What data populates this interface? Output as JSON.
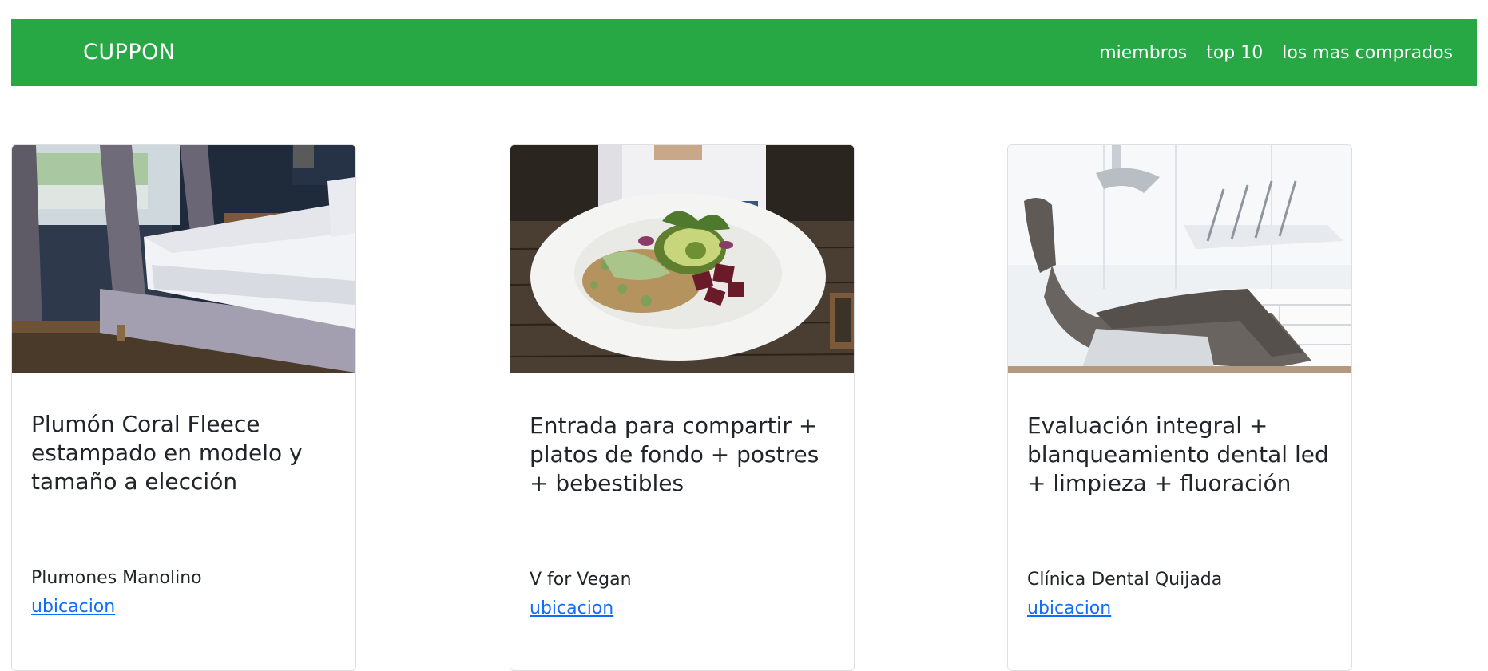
{
  "navbar": {
    "brand": "CUPPON",
    "links": [
      {
        "label": "miembros"
      },
      {
        "label": "top 10"
      },
      {
        "label": "los mas comprados"
      }
    ],
    "background_color": "#28a745"
  },
  "cards": [
    {
      "image": "bedroom-photo",
      "title": "Plumón Coral Fleece estampado en modelo y tamaño a elección",
      "vendor": "Plumones Manolino",
      "link": "ubicacion"
    },
    {
      "image": "vegan-food-plate-photo",
      "title": "Entrada para compartir + platos de fondo + postres + bebestibles",
      "vendor": "V for Vegan",
      "link": "ubicacion"
    },
    {
      "image": "dental-chair-photo",
      "title": "Evaluación integral + blanqueamiento dental led + limpieza + fluoración",
      "vendor": "Clínica Dental Quijada",
      "link": "ubicacion"
    }
  ],
  "colors": {
    "link": "#0d6efd",
    "card_border": "#dfdfdf"
  }
}
